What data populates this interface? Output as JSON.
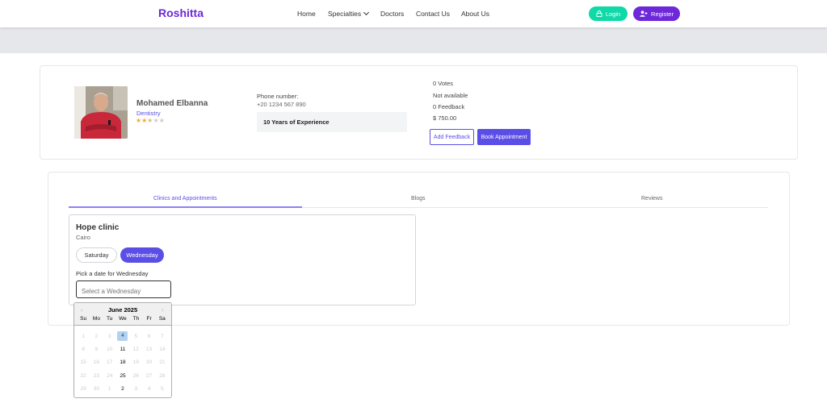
{
  "navbar": {
    "brand": "Roshitta",
    "links": [
      "Home",
      "Specialties",
      "Doctors",
      "Contact Us",
      "About Us"
    ],
    "login_label": "Login",
    "register_label": "Register"
  },
  "doctor": {
    "name": "Mohamed Elbanna",
    "specialty": "Dentistry",
    "rating": 2.5,
    "rating_max": 5,
    "phone_label": "Phone number:",
    "phone": "+20 1234 567 890",
    "experience": "10 Years of Experience",
    "votes": "0 Votes",
    "availability": "Not available",
    "feedback_count": "0 Feedback",
    "price": "$ 750.00",
    "add_feedback_label": "Add Feedback",
    "book_label": "Book Appointment"
  },
  "tabs": {
    "items": [
      "Clinics and Appointments",
      "Blogs",
      "Reviews"
    ],
    "active": "Clinics and Appointments"
  },
  "clinic": {
    "name": "Hope clinic",
    "city": "Cairo",
    "days": [
      "Saturday",
      "Wednesday"
    ],
    "selected_day": "Wednesday",
    "pick_label": "Pick a date for Wednesday",
    "date_placeholder": "Select a Wednesday"
  },
  "calendar": {
    "title": "June 2025",
    "weekdays": [
      "Su",
      "Mo",
      "Tu",
      "We",
      "Th",
      "Fr",
      "Sa"
    ],
    "weeks": [
      [
        "1",
        "2",
        "3",
        "4",
        "5",
        "6",
        "7"
      ],
      [
        "8",
        "9",
        "10",
        "11",
        "12",
        "13",
        "14"
      ],
      [
        "15",
        "16",
        "17",
        "18",
        "19",
        "20",
        "21"
      ],
      [
        "22",
        "23",
        "24",
        "25",
        "26",
        "27",
        "28"
      ],
      [
        "29",
        "30",
        "1",
        "2",
        "3",
        "4",
        "5"
      ]
    ],
    "enabled_days": [
      "4",
      "11",
      "18",
      "25",
      "2"
    ],
    "selected": "4"
  }
}
